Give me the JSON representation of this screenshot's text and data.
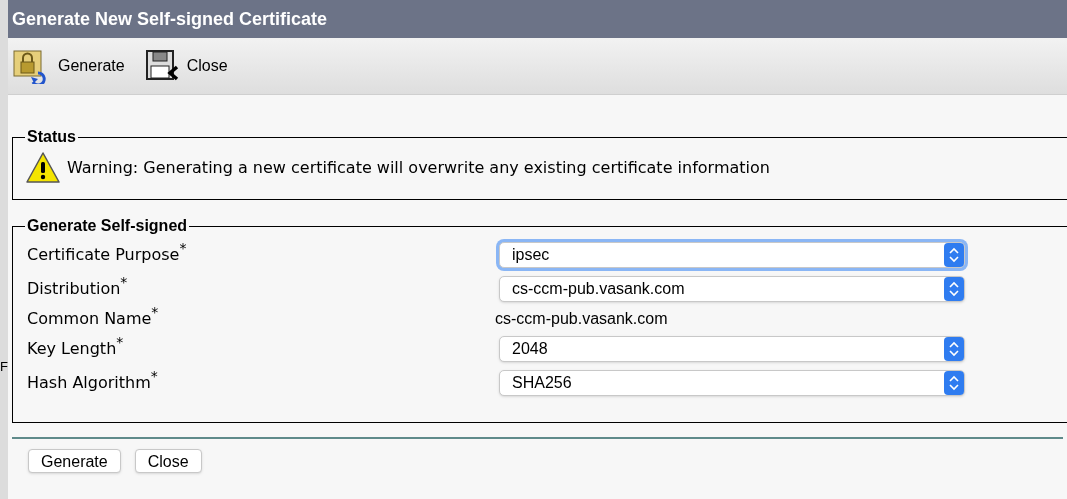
{
  "background_window": {
    "fragment": "F"
  },
  "window": {
    "title": "Generate New Self-signed Certificate"
  },
  "toolbar": [
    {
      "kind": "generate",
      "label": "Generate"
    },
    {
      "kind": "close",
      "label": "Close"
    }
  ],
  "status": {
    "legend": "Status",
    "message": "Warning: Generating a new certificate will overwrite any existing certificate information"
  },
  "form": {
    "legend": "Generate Self-signed",
    "fields": [
      {
        "label": "Certificate Purpose",
        "required_mark": "*",
        "kind": "select",
        "value": "ipsec",
        "focused": true
      },
      {
        "label": "Distribution",
        "required_mark": "*",
        "kind": "select",
        "value": "cs-ccm-pub.vasank.com",
        "focused": false
      },
      {
        "label": "Common Name",
        "required_mark": "*",
        "kind": "text",
        "value": "cs-ccm-pub.vasank.com"
      },
      {
        "label": "Key Length",
        "required_mark": "*",
        "kind": "select",
        "value": "2048",
        "focused": false
      },
      {
        "label": "Hash Algorithm",
        "required_mark": "*",
        "kind": "select",
        "value": "SHA256",
        "focused": false
      }
    ]
  },
  "buttons": [
    "Generate",
    "Close"
  ]
}
